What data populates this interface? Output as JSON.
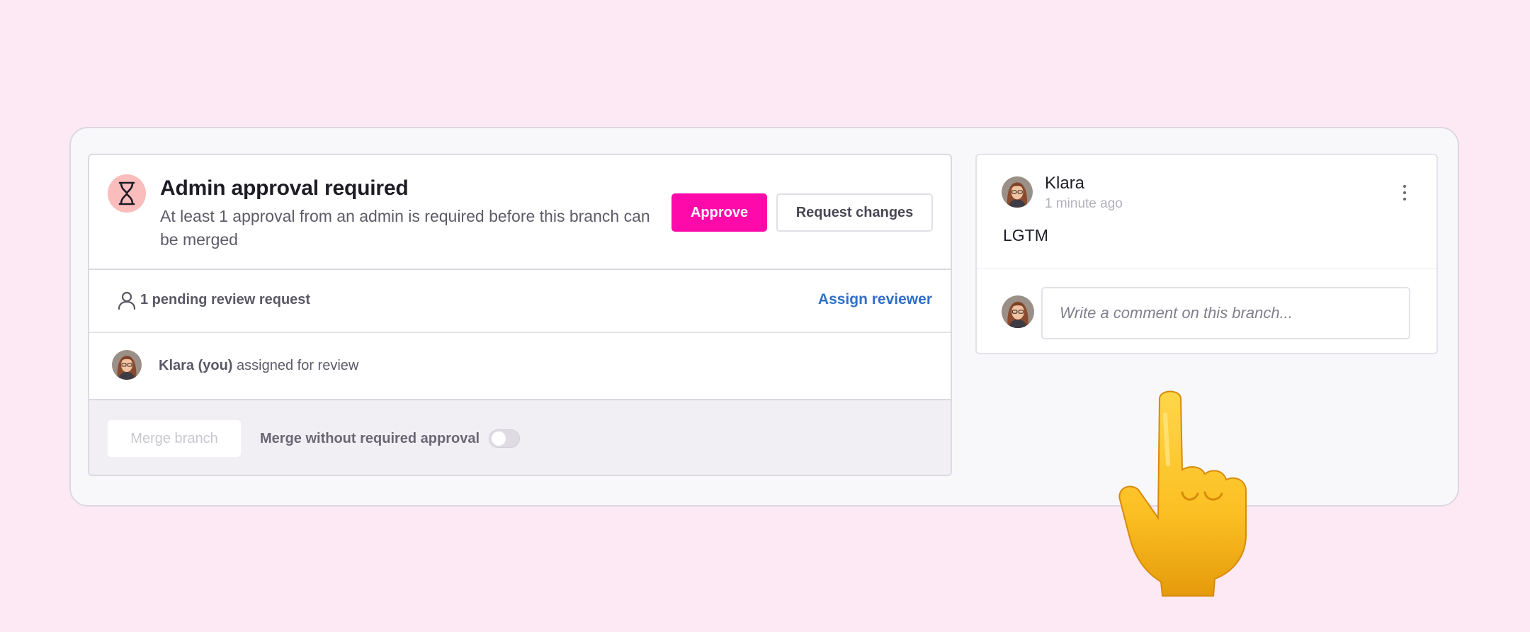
{
  "approval": {
    "title": "Admin approval required",
    "subtitle": "At least 1 approval from an admin is required before this branch can be merged",
    "approve_label": "Approve",
    "request_changes_label": "Request changes",
    "icon": "hourglass-icon"
  },
  "review": {
    "pending_text": "1 pending review request",
    "assign_label": "Assign reviewer",
    "reviewer_name": "Klara (you)",
    "reviewer_suffix": "assigned for review"
  },
  "merge": {
    "merge_button_label": "Merge branch",
    "merge_without_label": "Merge without required approval",
    "toggle_on": false
  },
  "comment": {
    "author": "Klara",
    "time": "1 minute ago",
    "body": "LGTM",
    "input_placeholder": "Write a comment on this branch..."
  },
  "colors": {
    "page_bg": "#fde9f4",
    "accent_pink": "#ff0aaa",
    "link_blue": "#2f6fc8",
    "hourglass_bg": "#fbbcbc"
  }
}
